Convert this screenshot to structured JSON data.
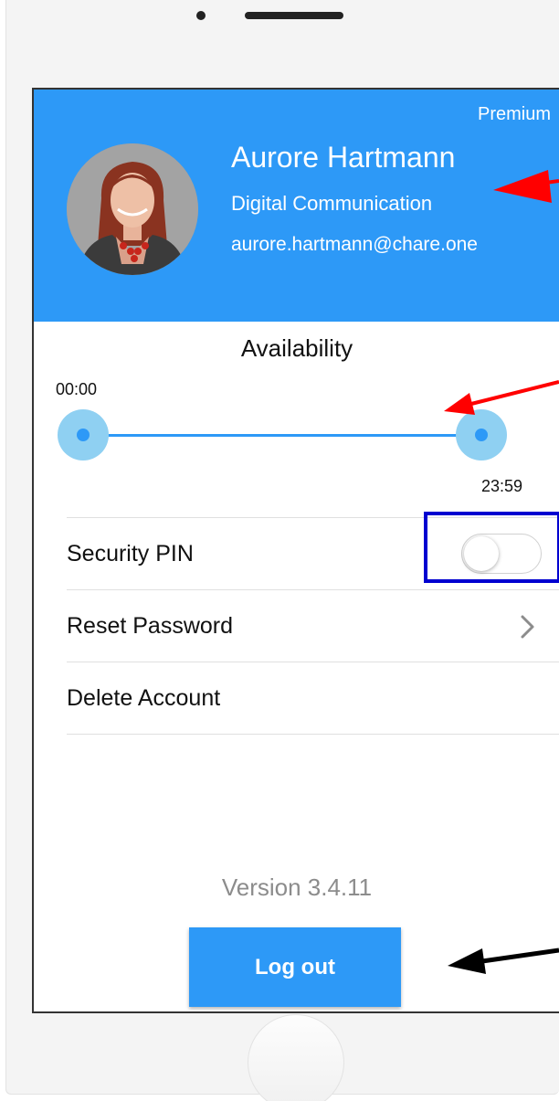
{
  "profile": {
    "plan_badge": "Premium",
    "name": "Aurore Hartmann",
    "department": "Digital Communication",
    "email": "aurore.hartmann@chare.one"
  },
  "availability": {
    "title": "Availability",
    "start_time": "00:00",
    "end_time": "23:59",
    "range_fraction": [
      0,
      1
    ]
  },
  "settings": {
    "security_pin_label": "Security PIN",
    "security_pin_enabled": false,
    "reset_password_label": "Reset Password",
    "delete_account_label": "Delete Account"
  },
  "footer": {
    "version": "Version 3.4.11",
    "logout_label": "Log out"
  },
  "colors": {
    "accent": "#2d99f7",
    "slider_thumb": "#8fd0f2",
    "annotation_red": "#ff0000",
    "annotation_blue": "#0000d0",
    "annotation_black": "#000000"
  },
  "icons": {
    "reset_password_chevron": "chevron-right-icon"
  }
}
